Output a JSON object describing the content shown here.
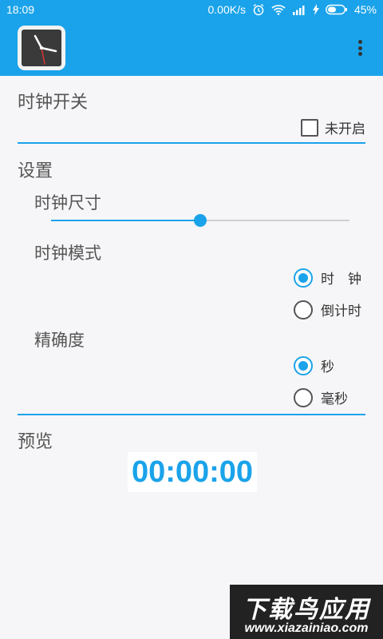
{
  "status_bar": {
    "time": "18:09",
    "network_speed": "0.00K/s",
    "battery": "45%",
    "icons": [
      "alarm-icon",
      "wifi-icon",
      "signal-icon",
      "charging-icon",
      "battery-icon"
    ]
  },
  "app_bar": {
    "icon": "clock-icon",
    "menu": "overflow-menu-icon"
  },
  "clock_switch": {
    "title": "时钟开关",
    "checkbox_label": "未开启",
    "checked": false
  },
  "settings": {
    "title": "设置",
    "size": {
      "title": "时钟尺寸",
      "value_fraction": 0.5
    },
    "mode": {
      "title": "时钟模式",
      "options": [
        {
          "label": "时　钟",
          "selected": true
        },
        {
          "label": "倒计时",
          "selected": false
        }
      ]
    },
    "precision": {
      "title": "精确度",
      "options": [
        {
          "label": "秒",
          "selected": true
        },
        {
          "label": "毫秒",
          "selected": false
        }
      ]
    }
  },
  "preview": {
    "title": "预览",
    "time": "00:00:00"
  },
  "watermark": {
    "line1": "下载鸟应用",
    "line2": "www.xiazainiao.com"
  },
  "colors": {
    "accent": "#1aa3ea",
    "text": "#555555"
  }
}
